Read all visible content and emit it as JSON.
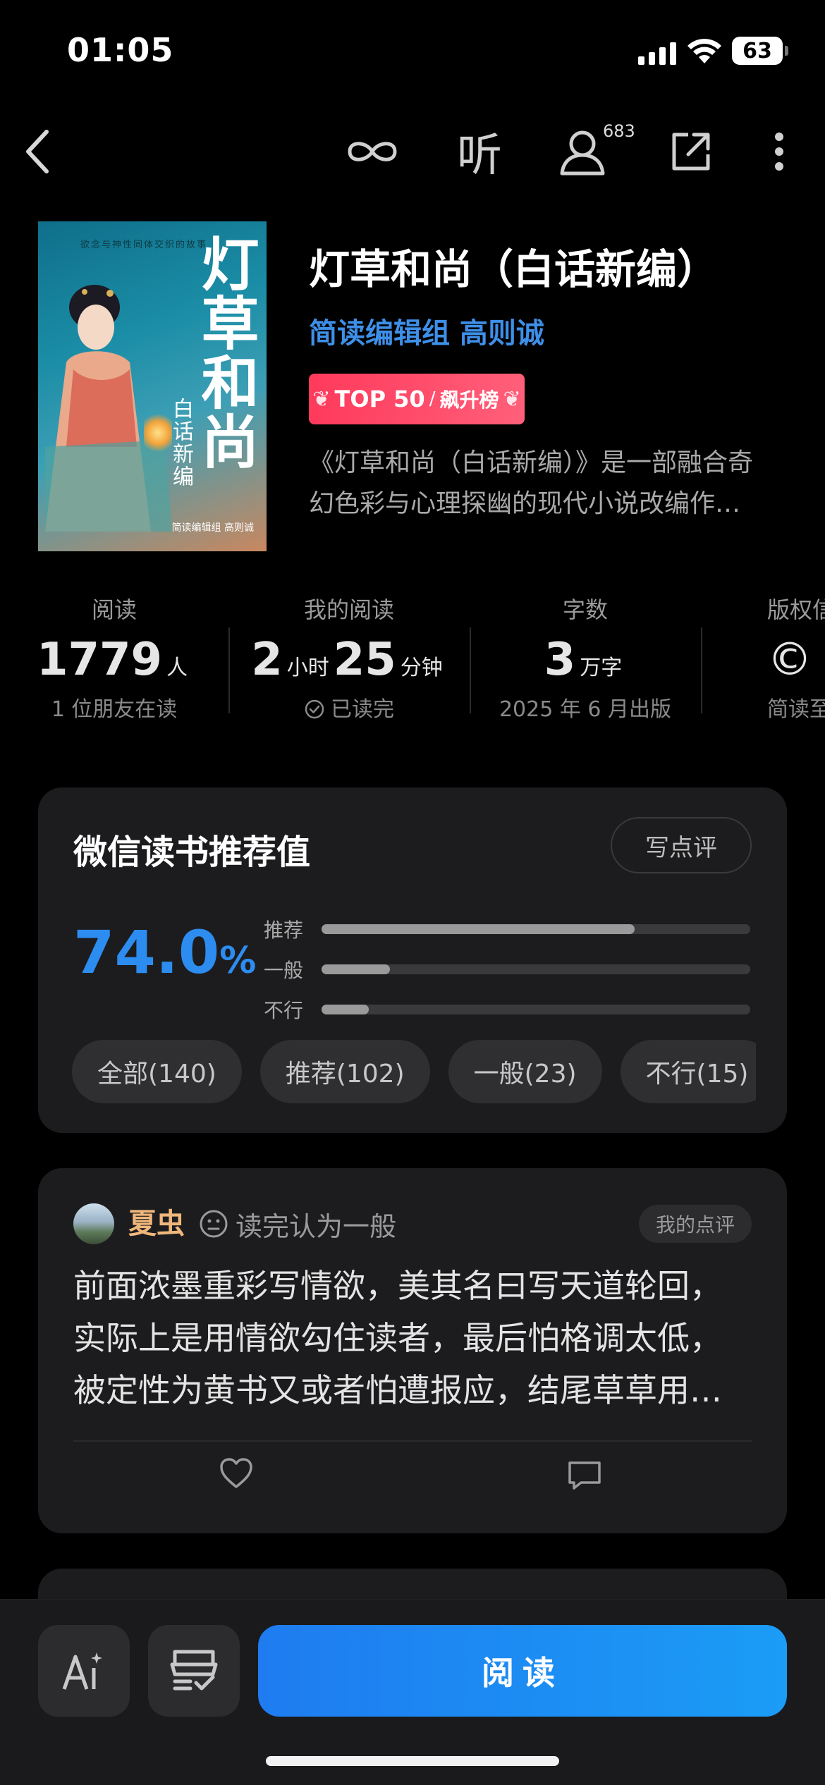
{
  "status_bar": {
    "time": "01:05",
    "battery": "63"
  },
  "nav": {
    "listen_label": "听",
    "follower_count": "683"
  },
  "book": {
    "title": "灯草和尚（白话新编）",
    "authors": "简读编辑组 高则诚",
    "badge": {
      "top": "TOP 50",
      "slash": "/",
      "text": "飙升榜"
    },
    "description_line1": "《灯草和尚（白话新编）》是一部融合奇",
    "description_line2": "幻色彩与心理探幽的现代小说改编作…",
    "cover": {
      "title": "灯草和尚",
      "subtitle": "白话新编",
      "author": "简读编辑组 高则诚",
      "tagline": "欲念与神性同体交织的故事"
    }
  },
  "stats": {
    "readers": {
      "label": "阅读",
      "value": "1779",
      "unit": "人",
      "sub": "1 位朋友在读"
    },
    "my_reading": {
      "label": "我的阅读",
      "hours": "2",
      "hours_unit": "小时",
      "minutes": "25",
      "minutes_unit": "分钟",
      "sub": "已读完"
    },
    "words": {
      "label": "字数",
      "value": "3",
      "unit": "万字",
      "sub": "2025 年 6 月出版"
    },
    "copyright": {
      "label": "版权信",
      "value": "©",
      "sub": "简读至"
    }
  },
  "recommend": {
    "title": "微信读书推荐值",
    "write_button": "写点评",
    "percent_value": "74.0",
    "percent_sign": "%",
    "bars": [
      {
        "label": "推荐",
        "fraction": 0.73
      },
      {
        "label": "一般",
        "fraction": 0.16
      },
      {
        "label": "不行",
        "fraction": 0.11
      }
    ],
    "filters": [
      "全部(140)",
      "推荐(102)",
      "一般(23)",
      "不行(15)"
    ]
  },
  "review": {
    "name": "夏虫",
    "status": "读完认为一般",
    "tag": "我的点评",
    "line1": "前面浓墨重彩写情欲，美其名曰写天道轮回，",
    "line2": "实际上是用情欲勾住读者，最后怕格调太低，",
    "line3": "被定性为黄书又或者怕遭报应，结尾草草用…"
  },
  "bottom_bar": {
    "read_button": "阅读"
  },
  "colors": {
    "accent": "#2d8cf0",
    "author": "#3e8fe8",
    "badge": "#ff3a5c",
    "reviewer": "#f0b77c"
  }
}
